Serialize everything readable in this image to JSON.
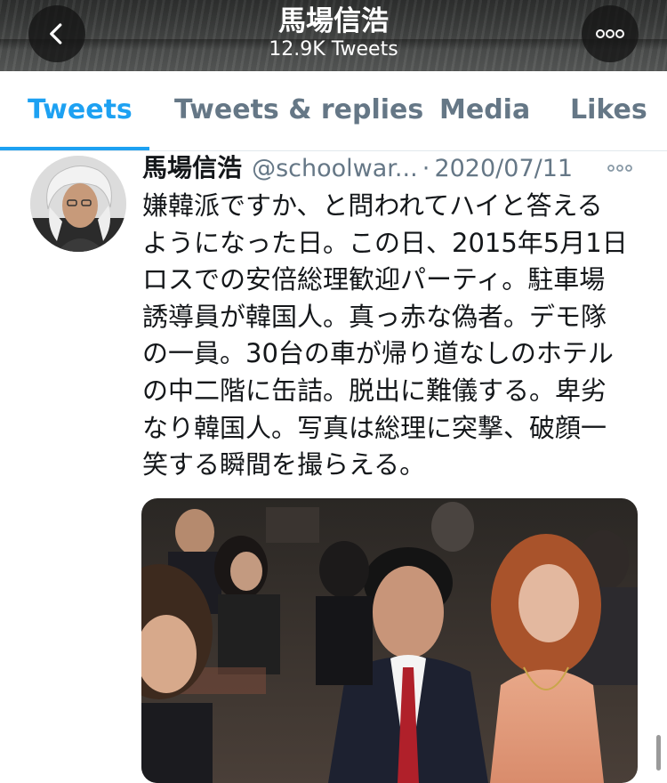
{
  "header": {
    "title": "馬場信浩",
    "tweet_count": "12.9K Tweets",
    "back_icon": "chevron-left-icon",
    "more_icon": "more-horizontal-icon"
  },
  "tabs": [
    {
      "label": "Tweets",
      "active": true
    },
    {
      "label": "Tweets & replies",
      "active": false
    },
    {
      "label": "Media",
      "active": false
    },
    {
      "label": "Likes",
      "active": false
    }
  ],
  "tweet": {
    "display_name": "馬場信浩",
    "handle": "@schoolwar...",
    "separator": "·",
    "date": "2020/07/11",
    "text_lines": [
      "嫌韓派ですか、と問われてハイと答える",
      "ようになった日。この日、2015年5月1日",
      "ロスでの安倍総理歓迎パーティ。駐車場",
      "誘導員が韓国人。真っ赤な偽者。デモ隊",
      "の一員。30台の車が帰り道なしのホテル",
      "の中二階に缶詰。脱出に難儀する。卑劣",
      "なり韓国人。写真は総理に突撃、破顔一",
      "笑する瞬間を撮らえる。"
    ]
  },
  "colors": {
    "accent": "#1da1f2",
    "muted_text": "#657786",
    "primary_text": "#14171a",
    "divider": "#e1e8ed"
  }
}
